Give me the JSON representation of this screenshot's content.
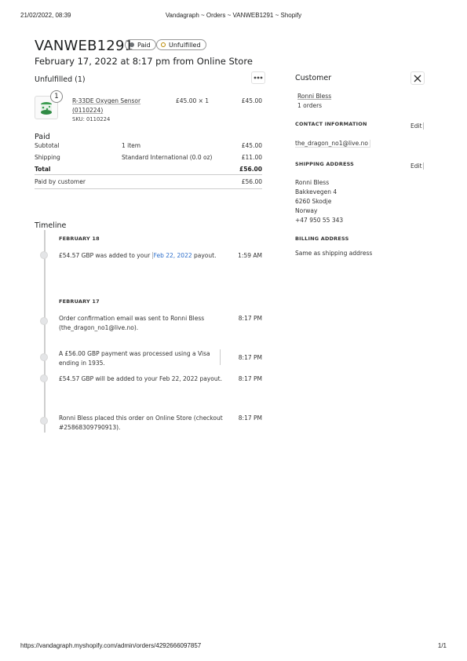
{
  "print_header": {
    "datetime": "21/02/2022, 08:39",
    "title": "Vandagraph ~ Orders ~ VANWEB1291 ~ Shopify"
  },
  "print_footer": {
    "url": "https://vandagraph.myshopify.com/admin/orders/4292666097857",
    "page": "1/1"
  },
  "order": {
    "number": "VANWEB1291",
    "paid_badge": "Paid",
    "fulfillment_badge": "Unfulfilled",
    "subtitle": "February 17, 2022 at 8:17 pm from Online Store"
  },
  "unfulfilled": {
    "heading": "Unfulfilled (1)",
    "more_icon": "more-horizontal-icon",
    "item": {
      "quantity_badge": "1",
      "name_line1": "R-33DE Oxygen Sensor",
      "name_line2": "(0110224)",
      "sku": "SKU: 0110224",
      "price_qty": "£45.00 × 1",
      "total": "£45.00"
    }
  },
  "payment": {
    "heading": "Paid",
    "rows": [
      {
        "label": "Subtotal",
        "detail": "1 item",
        "amount": "£45.00"
      },
      {
        "label": "Shipping",
        "detail": "Standard International (0.0 oz)",
        "amount": "£11.00"
      },
      {
        "label": "Total",
        "detail": "",
        "amount": "£56.00"
      }
    ],
    "paid_by_label": "Paid by customer",
    "paid_by_amount": "£56.00"
  },
  "timeline": {
    "heading": "Timeline",
    "groups": [
      {
        "date": "FEBRUARY 18",
        "events": [
          {
            "text_before": "£54.57 GBP was added to your ",
            "link": "Feb 22, 2022",
            "text_after": " payout.",
            "time": "1:59 AM"
          }
        ]
      },
      {
        "date": "FEBRUARY 17",
        "events": [
          {
            "line1": "Order confirmation email was sent to Ronni Bless",
            "line2": "(the_dragon_no1@live.no).",
            "time": "8:17 PM"
          },
          {
            "line1": "A £56.00 GBP payment was processed using a Visa",
            "line2": "ending in 1935.",
            "time": "8:17 PM"
          },
          {
            "line1": "£54.57 GBP will be added to your Feb 22, 2022 payout.",
            "time": "8:17 PM"
          },
          {
            "line1": "Ronni Bless placed this order on Online Store (checkout",
            "line2": "#25868309790913).",
            "time": "8:17 PM"
          }
        ]
      }
    ]
  },
  "customer": {
    "heading": "Customer",
    "close_icon": "close-icon",
    "name": "Ronni Bless",
    "orders": "1 orders",
    "contact_heading": "CONTACT INFORMATION",
    "contact_edit": "Edit",
    "email": "the_dragon_no1@live.no",
    "shipping_heading": "SHIPPING ADDRESS",
    "shipping_edit": "Edit",
    "address": [
      "Ronni Bless",
      "Bakkevegen 4",
      "6260 Skodje",
      "Norway",
      "+47 950 55 343"
    ],
    "billing_heading": "BILLING ADDRESS",
    "billing_text": "Same as shipping address"
  }
}
